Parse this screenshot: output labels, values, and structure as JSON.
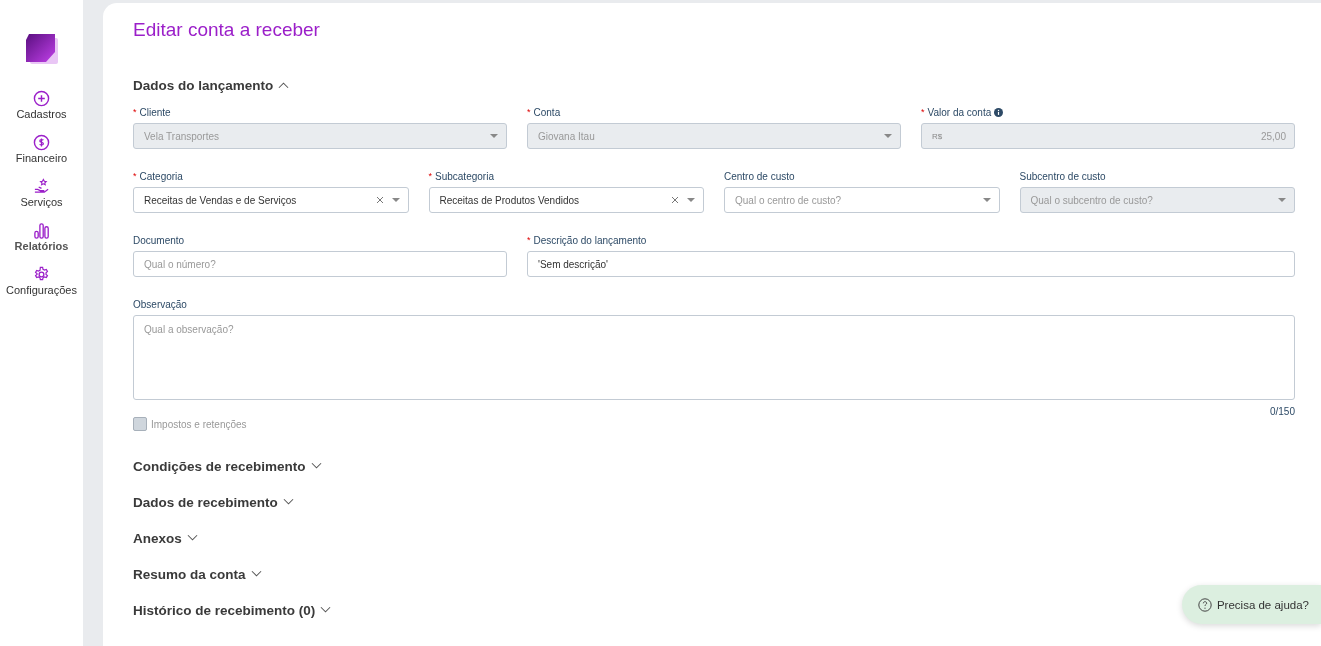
{
  "sidebar": {
    "items": [
      {
        "label": "Cadastros",
        "kind": "plus",
        "selected": false
      },
      {
        "label": "Financeiro",
        "kind": "dollar",
        "selected": false
      },
      {
        "label": "Serviços",
        "kind": "hand",
        "selected": false
      },
      {
        "label": "Relatórios",
        "kind": "bars",
        "selected": true
      },
      {
        "label": "Configurações",
        "kind": "gear",
        "selected": false
      }
    ]
  },
  "page": {
    "title": "Editar conta a receber"
  },
  "main_section": {
    "title": "Dados do lançamento",
    "expanded": true
  },
  "form_rows": [
    {
      "kind": "thirds",
      "fields": [
        {
          "label": "Cliente",
          "required_mark": "*",
          "kind": "select",
          "value": "Vela Transportes",
          "disabled": true
        },
        {
          "label": "Conta",
          "required_mark": "*",
          "kind": "select",
          "value": "Giovana Itau",
          "disabled": true
        },
        {
          "label": "Valor da conta",
          "required_mark": "*",
          "kind": "currency",
          "prefix": "R$",
          "value": "25,00",
          "disabled": true
        }
      ]
    },
    {
      "kind": "quarters",
      "fields": [
        {
          "label": "Categoria",
          "required_mark": "*",
          "kind": "select",
          "value": "Receitas de Vendas e de Serviços",
          "disabled": false
        },
        {
          "label": "Subcategoria",
          "required_mark": "*",
          "kind": "select",
          "value": "Receitas de Produtos Vendidos",
          "disabled": false
        },
        {
          "label": "Centro de custo",
          "kind": "select",
          "placeholder": "Qual o centro de custo?",
          "disabled": false
        },
        {
          "label": "Subcentro de custo",
          "kind": "select",
          "placeholder": "Qual o subcentro de custo?",
          "disabled": true
        }
      ]
    },
    {
      "kind": "third-and-wide",
      "fields": [
        {
          "label": "Documento",
          "kind": "text",
          "placeholder": "Qual o número?",
          "disabled": false
        },
        {
          "label": "Descrição do lançamento",
          "required_mark": "*",
          "kind": "text",
          "value": "'Sem descrição'",
          "disabled": false
        }
      ]
    }
  ],
  "observation": {
    "label": "Observação",
    "placeholder": "Qual a observação?",
    "counter": "0/150"
  },
  "taxes_checkbox": {
    "label": "Impostos e retenções",
    "checked": false,
    "disabled": true
  },
  "collapsed_sections": [
    {
      "title": "Condições de recebimento",
      "expanded": false
    },
    {
      "title": "Dados de recebimento",
      "expanded": false
    },
    {
      "title": "Anexos",
      "expanded": false
    },
    {
      "title": "Resumo da conta",
      "expanded": false
    },
    {
      "title": "Histórico de recebimento (0)",
      "expanded": false
    }
  ],
  "help_button": {
    "label": "Precisa de ajuda?"
  }
}
